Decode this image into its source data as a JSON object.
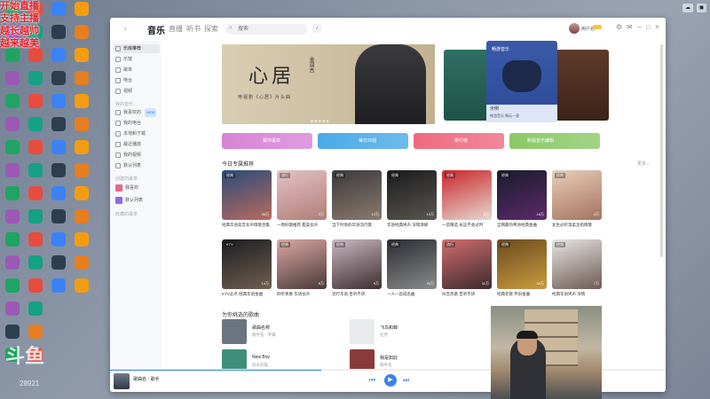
{
  "overlay": {
    "lines": [
      "开始直播",
      "支持主播",
      "越长越帅",
      "越来越美"
    ]
  },
  "watermark": {
    "logo": "斗鱼",
    "id": "28921"
  },
  "window": {
    "nav": {
      "back": "‹",
      "tabs": [
        "音乐",
        "直播",
        "听书",
        "探索"
      ],
      "active": "音乐"
    },
    "search": {
      "placeholder": "搜索"
    },
    "user": {
      "name": "用户名"
    },
    "controls": [
      "⚙",
      "✉",
      "–",
      "□",
      "×"
    ]
  },
  "sidebar": {
    "items": [
      {
        "label": "乐库推荐",
        "active": true
      },
      {
        "label": "乐馆"
      },
      {
        "label": "歌单"
      },
      {
        "label": "电台"
      },
      {
        "label": "视频"
      }
    ],
    "my_music_header": "我的音乐",
    "my_items": [
      {
        "label": "我喜欢的",
        "badge": "NEW"
      },
      {
        "label": "我的电台"
      },
      {
        "label": "本地和下载"
      },
      {
        "label": "最近播放"
      },
      {
        "label": "我的视频"
      },
      {
        "label": "默认列表"
      }
    ],
    "created_header": "创建的歌单",
    "playlists": [
      {
        "label": "我喜欢",
        "color": "#e8688a"
      },
      {
        "label": "默认列表",
        "color": "#8a6ee0"
      }
    ],
    "collected_header": "收藏的歌单"
  },
  "banner": {
    "title": "心居",
    "artist": "金润吉",
    "subtitle": "电视剧《心居》片头曲",
    "promo_title": "畅游音乐",
    "promo_foot_title": "示例",
    "promo_foot_sub": "畅游音乐 畅玩一夏"
  },
  "quick_buttons": [
    {
      "label": "猜你喜欢",
      "color": "#d883d6"
    },
    {
      "label": "每日30首",
      "color": "#4aaae8"
    },
    {
      "label": "排行榜",
      "color": "#ee6a7f"
    },
    {
      "label": "新版音乐编辑",
      "color": "#8bc968"
    }
  ],
  "section_recommend": {
    "title": "今日专属推荐",
    "more": "更多 ›"
  },
  "cards": [
    {
      "tag": "经典",
      "count": "36万",
      "title": "经典华语高音女声情歌合集",
      "c1": "#2a4b7a",
      "c2": "#b86b5e"
    },
    {
      "tag": "流行",
      "count": "2万",
      "title": "一周好歌推荐 甜美女声",
      "c1": "#e4c1c4",
      "c2": "#b07e77"
    },
    {
      "tag": "经典",
      "count": "12万",
      "title": "当下时尚的华语流行歌",
      "c1": "#3b3a3d",
      "c2": "#8a7a6d"
    },
    {
      "tag": "经典",
      "count": "10万",
      "title": "华语经典男声 深情演绎",
      "c1": "#1b1b1e",
      "c2": "#5a5650"
    },
    {
      "tag": "经典",
      "count": "6万",
      "title": "一首精选 永远不会过时",
      "c1": "#c9262a",
      "c2": "#e6d8d0"
    },
    {
      "tag": "经典",
      "count": "18万",
      "title": "全网最热粤语经典金曲",
      "c1": "#1a1c2b",
      "c2": "#5b2a6b"
    },
    {
      "tag": "经典",
      "count": "4万",
      "title": "女生必听温柔治愈情歌",
      "c1": "#e8cdb9",
      "c2": "#a3735f"
    },
    {
      "tag": "KTV",
      "count": "14万",
      "title": "KTV必点 经典华语金曲",
      "c1": "#1c1d22",
      "c2": "#706050"
    },
    {
      "tag": "经典",
      "count": "8万",
      "title": "聆听青春 华语女声",
      "c1": "#d9a7a0",
      "c2": "#4a3a3a"
    },
    {
      "tag": "经典",
      "count": "9万",
      "title": "流行华语 百听不厌",
      "c1": "#cbb7c0",
      "c2": "#3a2e30"
    },
    {
      "tag": "经典",
      "count": "20万",
      "title": "一人一首成名曲",
      "c1": "#2b2d33",
      "c2": "#8a8a8a"
    },
    {
      "tag": "流行",
      "count": "11万",
      "title": "抖音热歌 百听不厌",
      "c1": "#d36d6e",
      "c2": "#3a2a2e"
    },
    {
      "tag": "经典",
      "count": "25万",
      "title": "经典老歌 怀旧金曲",
      "c1": "#6b4b1f",
      "c2": "#c99a3e"
    },
    {
      "tag": "经典",
      "count": "7万",
      "title": "经典华语男声 深情",
      "c1": "#e8e4e2",
      "c2": "#6b5a54"
    }
  ],
  "section_songs": {
    "title": "为你挑选的歌曲"
  },
  "songs": [
    {
      "title": "歌曲名称",
      "artist": "歌手名 · 专辑",
      "color": "#6a7580"
    },
    {
      "title": "飞鸟和蝉",
      "artist": "任然",
      "color": "#e8eaec"
    },
    {
      "title": "New Boy",
      "artist": "房东的猫",
      "color": "#3e8f7a"
    },
    {
      "title": "我是如此",
      "artist": "歌手名",
      "color": "#8a3a3a"
    }
  ],
  "player": {
    "song": "歌曲名 - 歌手",
    "prev": "⏮",
    "play": "▶",
    "next": "⏭",
    "progress": 0.38
  }
}
